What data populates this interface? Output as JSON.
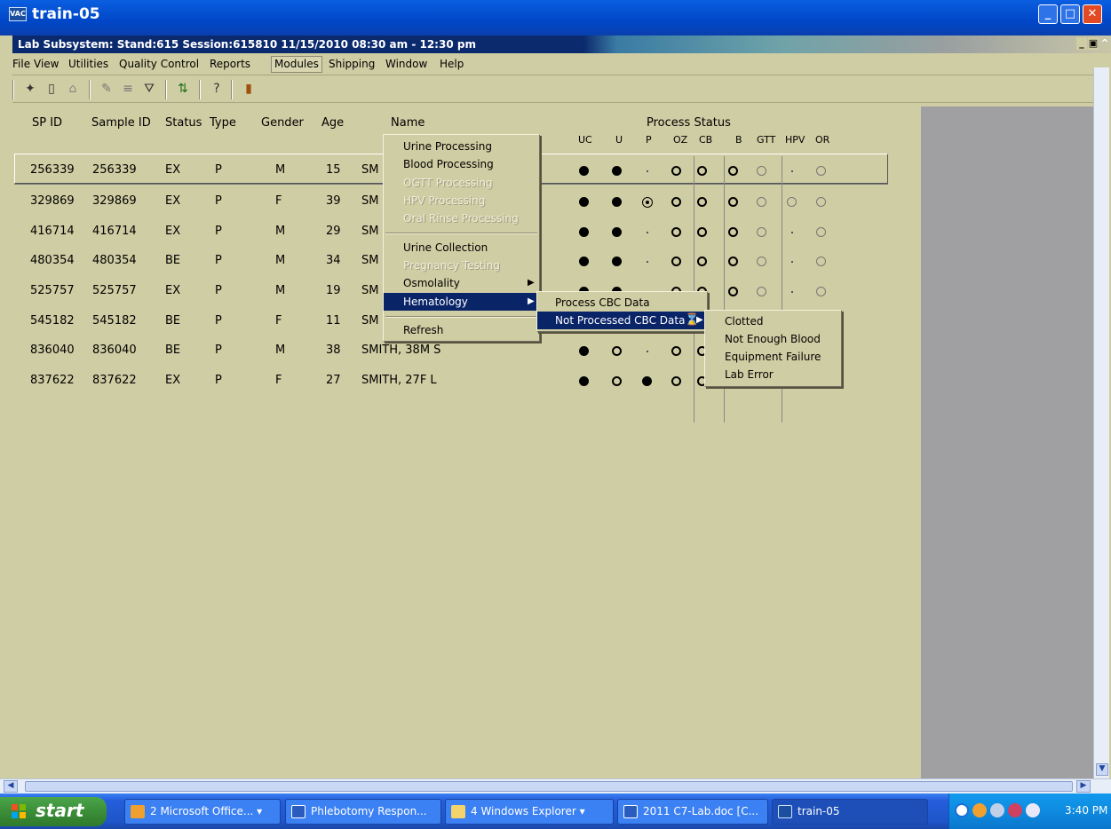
{
  "window": {
    "title": "train-05",
    "app_icon": "app-icon"
  },
  "inner_title": "Lab Subsystem: Stand:615 Session:615810 11/15/2010 08:30 am - 12:30 pm",
  "menubar": [
    "File",
    "View",
    "Utilities",
    "Quality Control",
    "Reports",
    "Modules",
    "Shipping",
    "Window",
    "Help"
  ],
  "columns": {
    "sp_id": "SP ID",
    "sample_id": "Sample ID",
    "status": "Status",
    "type": "Type",
    "gender": "Gender",
    "age": "Age",
    "name": "Name",
    "process_status": "Process Status",
    "process_codes": [
      "UC",
      "U",
      "P",
      "OZ",
      "CB",
      "B",
      "GTT",
      "HPV",
      "OR"
    ]
  },
  "rows": [
    {
      "sp_id": "256339",
      "sample_id": "256339",
      "status": "EX",
      "type": "P",
      "gender": "M",
      "age": "15",
      "name": "SM",
      "marks": [
        "fill",
        "fill",
        "dot",
        "ring",
        "ring",
        "ring",
        "ringlite",
        "dot",
        "ringlite"
      ]
    },
    {
      "sp_id": "329869",
      "sample_id": "329869",
      "status": "EX",
      "type": "P",
      "gender": "F",
      "age": "39",
      "name": "SM",
      "marks": [
        "fill",
        "fill",
        "ringdot",
        "ring",
        "ring",
        "ring",
        "ringlite",
        "ringlite",
        "ringlite"
      ]
    },
    {
      "sp_id": "416714",
      "sample_id": "416714",
      "status": "EX",
      "type": "P",
      "gender": "M",
      "age": "29",
      "name": "SM",
      "marks": [
        "fill",
        "fill",
        "dot",
        "ring",
        "ring",
        "ring",
        "ringlite",
        "dot",
        "ringlite"
      ]
    },
    {
      "sp_id": "480354",
      "sample_id": "480354",
      "status": "BE",
      "type": "P",
      "gender": "M",
      "age": "34",
      "name": "SM",
      "marks": [
        "fill",
        "fill",
        "dot",
        "ring",
        "ring",
        "ring",
        "ringlite",
        "dot",
        "ringlite"
      ]
    },
    {
      "sp_id": "525757",
      "sample_id": "525757",
      "status": "EX",
      "type": "P",
      "gender": "M",
      "age": "19",
      "name": "SM",
      "marks": [
        "fill",
        "fill",
        "dot",
        "ring",
        "ring",
        "ring",
        "ringlite",
        "dot",
        "ringlite"
      ]
    },
    {
      "sp_id": "545182",
      "sample_id": "545182",
      "status": "BE",
      "type": "P",
      "gender": "F",
      "age": "11",
      "name": "SM",
      "marks": [
        "fill",
        "ring",
        "fill",
        "ring",
        "ring",
        "ring",
        "ringlite",
        "dot",
        "ringlite"
      ]
    },
    {
      "sp_id": "836040",
      "sample_id": "836040",
      "status": "BE",
      "type": "P",
      "gender": "M",
      "age": "38",
      "name": "SMITH, 38M S",
      "marks": [
        "fill",
        "ring",
        "dot",
        "ring",
        "ring",
        "ring",
        "ringlite",
        "dot",
        "ringlite"
      ]
    },
    {
      "sp_id": "837622",
      "sample_id": "837622",
      "status": "EX",
      "type": "P",
      "gender": "F",
      "age": "27",
      "name": "SMITH, 27F L",
      "marks": [
        "fill",
        "ring",
        "fill",
        "ring",
        "ring",
        "ring",
        "ringlite",
        "ringlite",
        "ringlite"
      ]
    }
  ],
  "modules_menu": {
    "items": [
      {
        "label": "Urine Processing",
        "enabled": true
      },
      {
        "label": "Blood Processing",
        "enabled": true
      },
      {
        "label": "OGTT Processing",
        "enabled": false
      },
      {
        "label": "HPV Processing",
        "enabled": false
      },
      {
        "label": "Oral Rinse Processing",
        "enabled": false
      },
      {
        "label": "Urine Collection",
        "enabled": true
      },
      {
        "label": "Pregnancy Testing",
        "enabled": false
      },
      {
        "label": "Osmolality",
        "enabled": true
      },
      {
        "label": "Hematology",
        "enabled": true
      },
      {
        "label": "Refresh",
        "enabled": true
      }
    ]
  },
  "hematology_menu": {
    "items": [
      "Process CBC Data",
      "Not Processed CBC Data"
    ]
  },
  "not_processed_menu": {
    "items": [
      "Clotted",
      "Not Enough Blood",
      "Equipment Failure",
      "Lab Error"
    ]
  },
  "taskbar": {
    "start": "start",
    "tasks": [
      "2 Microsoft Office...",
      "Phlebotomy Respon...",
      "4 Windows Explorer",
      "2011 C7-Lab.doc [C...",
      "train-05"
    ],
    "clock": "3:40 PM"
  },
  "colors": {
    "background": "#cfcda3",
    "menu_highlight": "#0a2468",
    "title_blue": "#0047c8"
  }
}
